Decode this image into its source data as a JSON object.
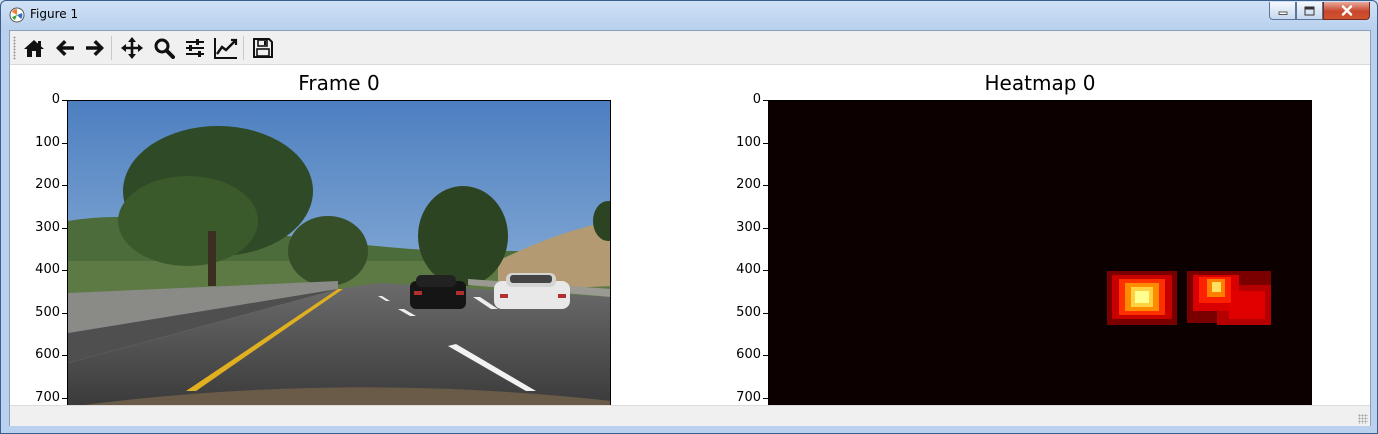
{
  "window": {
    "title": "Figure 1",
    "minimize_icon": "minimize-icon",
    "maximize_icon": "maximize-icon",
    "close_icon": "close-icon"
  },
  "toolbar": {
    "buttons": [
      {
        "name": "home",
        "icon": "home-icon"
      },
      {
        "name": "back",
        "icon": "arrow-left-icon"
      },
      {
        "name": "forward",
        "icon": "arrow-right-icon"
      },
      {
        "name": "pan",
        "icon": "move-icon"
      },
      {
        "name": "zoom",
        "icon": "magnifier-icon"
      },
      {
        "name": "subplots",
        "icon": "sliders-icon"
      },
      {
        "name": "customize",
        "icon": "line-chart-icon"
      },
      {
        "name": "save",
        "icon": "floppy-disk-icon"
      }
    ]
  },
  "figure": {
    "subplots": [
      {
        "title": "Frame 0",
        "yticks": [
          "0",
          "100",
          "200",
          "300",
          "400",
          "500",
          "600",
          "700"
        ],
        "content": "road-camera-frame"
      },
      {
        "title": "Heatmap 0",
        "yticks": [
          "0",
          "100",
          "200",
          "300",
          "400",
          "500",
          "600",
          "700"
        ],
        "content": "heatmap",
        "colormap": "hot",
        "background": "#0c0000"
      }
    ]
  },
  "colors": {
    "title_bar": "#b9d1ee",
    "close_button": "#c7462d",
    "toolbar_bg": "#f0f0f0"
  }
}
